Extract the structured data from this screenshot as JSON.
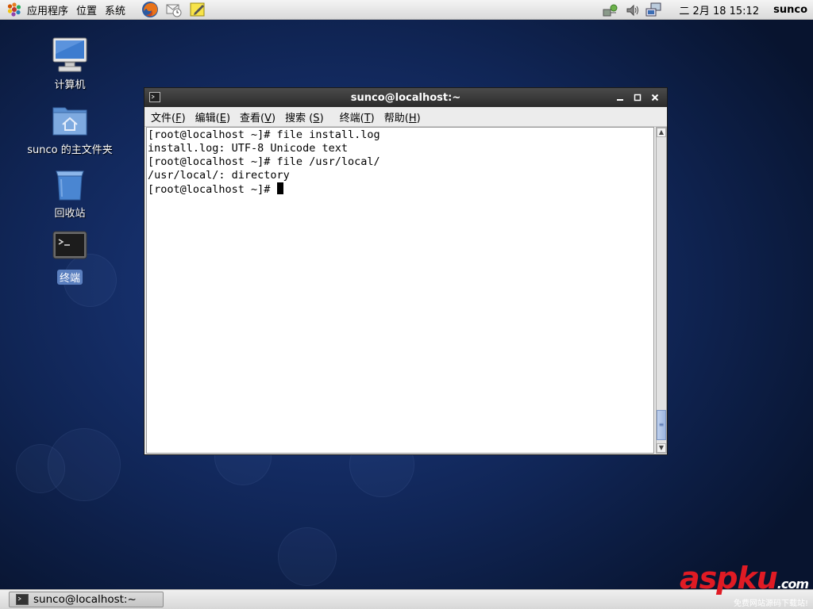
{
  "top_panel": {
    "menus": [
      "应用程序",
      "位置",
      "系统"
    ],
    "clock": "二 2月 18 15:12",
    "user": "sunco"
  },
  "desktop": {
    "icons": [
      {
        "label": "计算机"
      },
      {
        "label": "sunco 的主文件夹"
      },
      {
        "label": "回收站"
      },
      {
        "label": "终端"
      }
    ]
  },
  "terminal": {
    "title": "sunco@localhost:~",
    "menus": [
      {
        "text": "文件(",
        "key": "F",
        "end": ")"
      },
      {
        "text": "编辑(",
        "key": "E",
        "end": ")"
      },
      {
        "text": "查看(",
        "key": "V",
        "end": ")"
      },
      {
        "text": "搜索 (",
        "key": "S",
        "end": ")"
      },
      {
        "text": "终端(",
        "key": "T",
        "end": ")"
      },
      {
        "text": "帮助(",
        "key": "H",
        "end": ")"
      }
    ],
    "lines": [
      "[root@localhost ~]# file install.log",
      "install.log: UTF-8 Unicode text",
      "[root@localhost ~]# file /usr/local/",
      "/usr/local/: directory",
      "[root@localhost ~]# "
    ]
  },
  "taskbar": {
    "items": [
      {
        "label": "sunco@localhost:~"
      }
    ]
  },
  "watermark": {
    "brand": "aspku",
    "domain": ".com",
    "tagline": "免费网站源码下载站!"
  }
}
